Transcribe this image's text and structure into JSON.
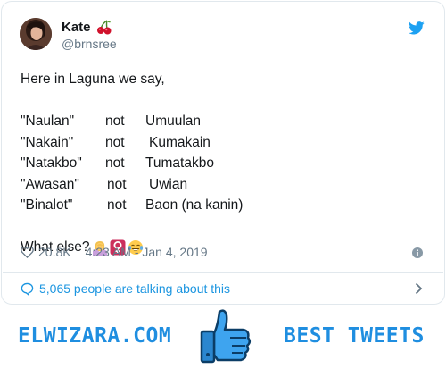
{
  "author": {
    "display_name": "Kate",
    "handle": "@brnsree",
    "name_emoji": "cherries-icon"
  },
  "tweet": {
    "intro": "Here in Laguna we say,",
    "pairs": [
      {
        "a": "\"Naulan\"",
        "sep": "not",
        "b": "Umuulan"
      },
      {
        "a": "\"Nakain\"",
        "sep": "not",
        "b": "Kumakain"
      },
      {
        "a": "\"Natakbo\"",
        "sep": "not",
        "b": "Tumatakbo"
      },
      {
        "a": "\"Awasan\"",
        "sep": "not",
        "b": "Uwian"
      },
      {
        "a": "\"Binalot\"",
        "sep": "not",
        "b": "Baon (na kanin)"
      }
    ],
    "closing": "What else?",
    "closing_emojis": [
      "woman-shrugging-icon",
      "female-sign-icon",
      "face-with-tears-of-joy-icon"
    ]
  },
  "meta": {
    "likes": "20.8K",
    "timestamp": "4:23 AM - Jan 4, 2019"
  },
  "talk": {
    "label": "5,065 people are talking about this"
  },
  "footer": {
    "brand_left": "ELWIZARA.COM",
    "brand_right": "BEST TWEETS"
  },
  "colors": {
    "twitter_blue": "#1da1f2",
    "link_blue": "#1b95e0",
    "footer_blue": "#1f8ee0",
    "muted": "#657786"
  }
}
